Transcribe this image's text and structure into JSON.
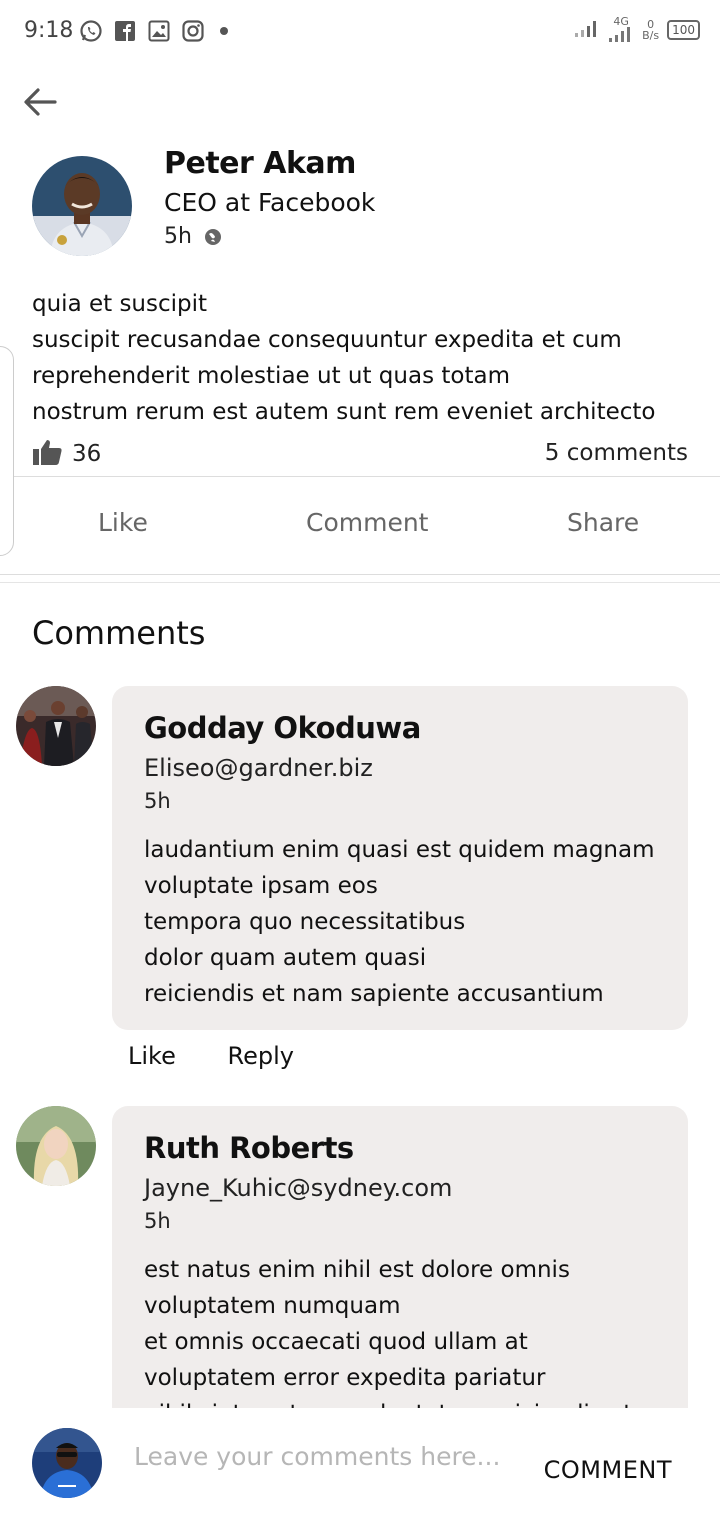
{
  "status_bar": {
    "time": "9:18",
    "network": "4G",
    "speed_value": "0",
    "speed_unit": "B/s",
    "battery": "100"
  },
  "post": {
    "author_name": "Peter Akam",
    "author_title": "CEO at Facebook",
    "time": "5h",
    "body": "quia et suscipit\nsuscipit recusandae consequuntur expedita et cum\nreprehenderit molestiae ut ut quas totam\nnostrum rerum est autem sunt rem eveniet architecto",
    "like_count": "36",
    "comment_count": "5 comments",
    "actions": {
      "like": "Like",
      "comment": "Comment",
      "share": "Share"
    }
  },
  "comments_section": {
    "heading": "Comments",
    "like_label": "Like",
    "reply_label": "Reply",
    "items": [
      {
        "name": "Godday Okoduwa",
        "email": "Eliseo@gardner.biz",
        "time": "5h",
        "text": "laudantium enim quasi est quidem magnam\nvoluptate ipsam eos\ntempora quo necessitatibus\ndolor quam autem quasi\nreiciendis et nam sapiente accusantium"
      },
      {
        "name": "Ruth Roberts",
        "email": "Jayne_Kuhic@sydney.com",
        "time": "5h",
        "text": "est natus enim nihil est dolore omnis\nvoluptatem numquam\net omnis occaecati quod ullam at\nvoluptatem error expedita pariatur\nnihil sint nostrum voluptatem reiciendis et"
      }
    ]
  },
  "composer": {
    "placeholder": "Leave your comments here...",
    "submit_label": "COMMENT"
  },
  "icons": {
    "back": "arrow-left-icon",
    "like": "thumbs-up-icon",
    "privacy": "globe-icon"
  }
}
